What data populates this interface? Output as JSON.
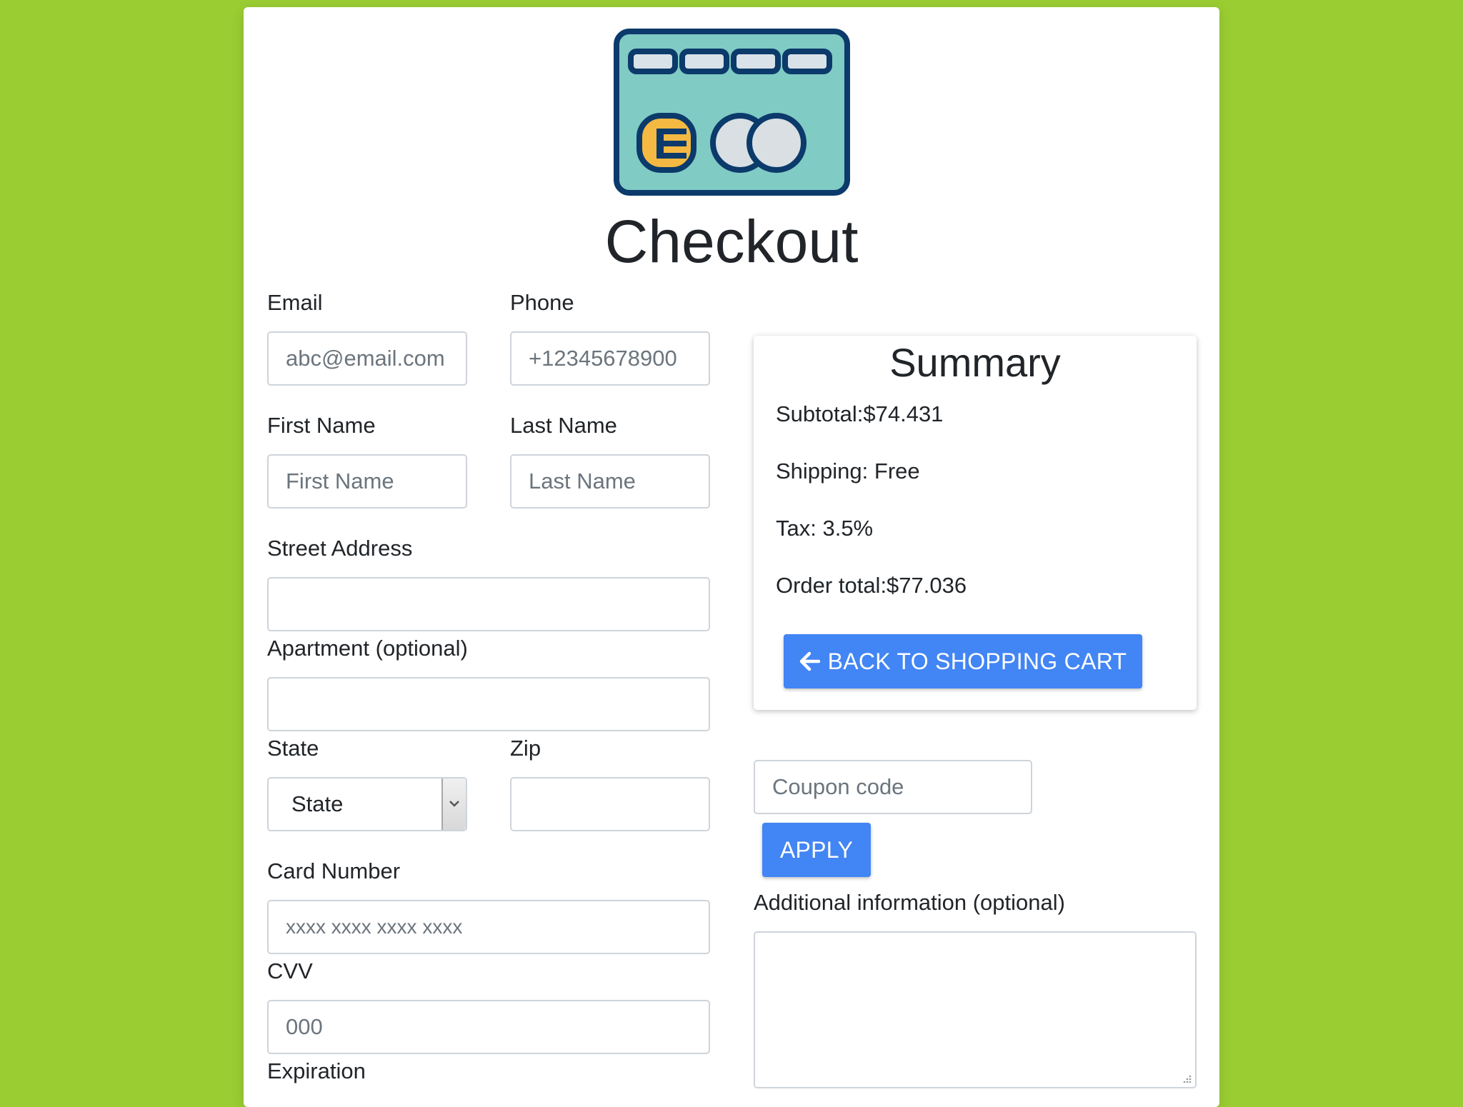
{
  "colors": {
    "page_background": "#9acd32",
    "card_background": "#ffffff",
    "primary_button": "#4285f4",
    "card_icon_fill": "#80cbc4",
    "card_icon_stroke": "#0b3a6b",
    "chip_color": "#f4b942"
  },
  "header": {
    "logo_icon": "credit-card-icon",
    "title": "Checkout"
  },
  "form": {
    "email": {
      "label": "Email",
      "placeholder": "abc@email.com"
    },
    "phone": {
      "label": "Phone",
      "placeholder": "+12345678900"
    },
    "first_name": {
      "label": "First Name",
      "placeholder": "First Name"
    },
    "last_name": {
      "label": "Last Name",
      "placeholder": "Last Name"
    },
    "street_address": {
      "label": "Street Address",
      "placeholder": ""
    },
    "apartment": {
      "label": "Apartment (optional)",
      "placeholder": ""
    },
    "state": {
      "label": "State",
      "selected": "State"
    },
    "zip": {
      "label": "Zip",
      "placeholder": ""
    },
    "card_number": {
      "label": "Card Number",
      "placeholder": "xxxx xxxx xxxx xxxx"
    },
    "cvv": {
      "label": "CVV",
      "placeholder": "000"
    },
    "expiration": {
      "label": "Expiration"
    }
  },
  "summary": {
    "title": "Summary",
    "subtotal": "Subtotal:$74.431",
    "shipping": "Shipping: Free",
    "tax": "Tax: 3.5%",
    "order_total": "Order total:$77.036",
    "back_button_icon": "arrow-left-icon",
    "back_button_label": "BACK TO SHOPPING CART"
  },
  "coupon": {
    "placeholder": "Coupon code",
    "apply_label": "APPLY"
  },
  "additional_info": {
    "label": "Additional information (optional)",
    "placeholder": ""
  }
}
